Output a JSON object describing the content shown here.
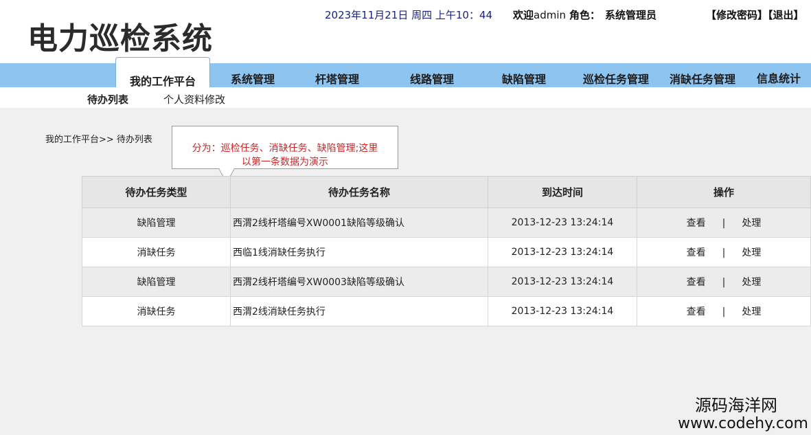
{
  "header": {
    "app_title": "电力巡检系统",
    "datetime": "2023年11月21日 周四 上午10：44",
    "welcome_prefix": "欢迎",
    "username": "admin",
    "role_label": "角色：",
    "role_value": "系统管理员",
    "change_password": "【修改密码】",
    "logout": "【退出】"
  },
  "nav": {
    "items": [
      {
        "label": "我的工作平台",
        "active": true
      },
      {
        "label": "系统管理"
      },
      {
        "label": "杆塔管理"
      },
      {
        "label": "线路管理"
      },
      {
        "label": "缺陷管理"
      },
      {
        "label": "巡检任务管理"
      },
      {
        "label": "消缺任务管理"
      },
      {
        "label": "信息统计"
      }
    ]
  },
  "subnav": {
    "items": [
      {
        "label": "待办列表",
        "active": true
      },
      {
        "label": "个人资料修改"
      }
    ]
  },
  "breadcrumb": "我的工作平台>>  待办列表",
  "callout": {
    "line1": "分为：巡检任务、消缺任务、缺陷管理;这里",
    "line2": "以第一条数据为演示"
  },
  "table": {
    "headers": [
      "待办任务类型",
      "待办任务名称",
      "到达时间",
      "操作"
    ],
    "rows": [
      {
        "type": "缺陷管理",
        "name": "西渭2线杆塔编号XW0001缺陷等级确认",
        "time": "2013-12-23 13:24:14",
        "view": "查看",
        "sep": "|",
        "process": "处理"
      },
      {
        "type": "消缺任务",
        "name": "西临1线消缺任务执行",
        "time": "2013-12-23 13:24:14",
        "view": "查看",
        "sep": "|",
        "process": "处理"
      },
      {
        "type": "缺陷管理",
        "name": "西渭2线杆塔编号XW0003缺陷等级确认",
        "time": "2013-12-23 13:24:14",
        "view": "查看",
        "sep": "|",
        "process": "处理"
      },
      {
        "type": "消缺任务",
        "name": "西渭2线消缺任务执行",
        "time": "2013-12-23 13:24:14",
        "view": "查看",
        "sep": "|",
        "process": "处理"
      }
    ]
  },
  "watermark": {
    "line1": "源码海洋网",
    "line2": "www.codehy.com"
  },
  "colors": {
    "nav_bar": "#8ec4f0",
    "datetime_text": "#1a237e",
    "callout_text": "#c62828"
  }
}
